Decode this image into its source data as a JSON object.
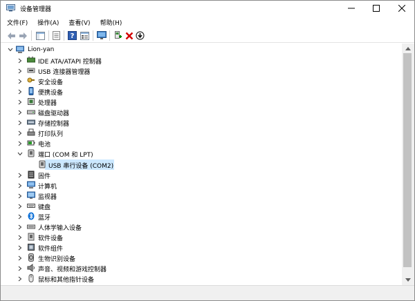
{
  "window": {
    "title": "设备管理器",
    "minimize_label": "—",
    "maximize_label": "☐",
    "close_label": "✕"
  },
  "menu": [
    {
      "label": "文件(F)"
    },
    {
      "label": "操作(A)"
    },
    {
      "label": "查看(V)"
    },
    {
      "label": "帮助(H)"
    }
  ],
  "toolbar": {
    "buttons": [
      "back-icon",
      "forward-icon",
      "show-hide-console-tree-icon",
      "properties-icon",
      "help-icon",
      "view-icon",
      "monitor-icon",
      "add-driver-icon",
      "uninstall-icon",
      "update-icon"
    ],
    "uninstall_color": "#d40000"
  },
  "tree": {
    "root": "Lion-yan",
    "items": [
      {
        "label": "IDE ATA/ATAPI 控制器",
        "icon": "ide-controller-icon"
      },
      {
        "label": "USB 连接器管理器",
        "icon": "usb-connector-icon"
      },
      {
        "label": "安全设备",
        "icon": "security-device-icon"
      },
      {
        "label": "便携设备",
        "icon": "portable-device-icon"
      },
      {
        "label": "处理器",
        "icon": "processor-icon"
      },
      {
        "label": "磁盘驱动器",
        "icon": "disk-drive-icon"
      },
      {
        "label": "存储控制器",
        "icon": "storage-controller-icon"
      },
      {
        "label": "打印队列",
        "icon": "print-queue-icon"
      },
      {
        "label": "电池",
        "icon": "battery-icon"
      },
      {
        "label": "端口 (COM 和 LPT)",
        "icon": "port-icon",
        "expanded": true
      },
      {
        "label": "USB 串行设备 (COM2)",
        "icon": "serial-port-icon",
        "child": true,
        "selected": true
      },
      {
        "label": "固件",
        "icon": "firmware-icon"
      },
      {
        "label": "计算机",
        "icon": "computer-icon"
      },
      {
        "label": "监视器",
        "icon": "monitor-icon"
      },
      {
        "label": "键盘",
        "icon": "keyboard-icon"
      },
      {
        "label": "蓝牙",
        "icon": "bluetooth-icon"
      },
      {
        "label": "人体学输入设备",
        "icon": "hid-icon"
      },
      {
        "label": "软件设备",
        "icon": "software-device-icon"
      },
      {
        "label": "软件组件",
        "icon": "software-component-icon"
      },
      {
        "label": "生物识别设备",
        "icon": "biometric-icon"
      },
      {
        "label": "声音、视频和游戏控制器",
        "icon": "sound-video-icon"
      },
      {
        "label": "鼠标和其他指针设备",
        "icon": "mouse-icon"
      }
    ]
  },
  "colors": {
    "selection": "#cce8ff",
    "bluetooth": "#0a6fd8"
  }
}
